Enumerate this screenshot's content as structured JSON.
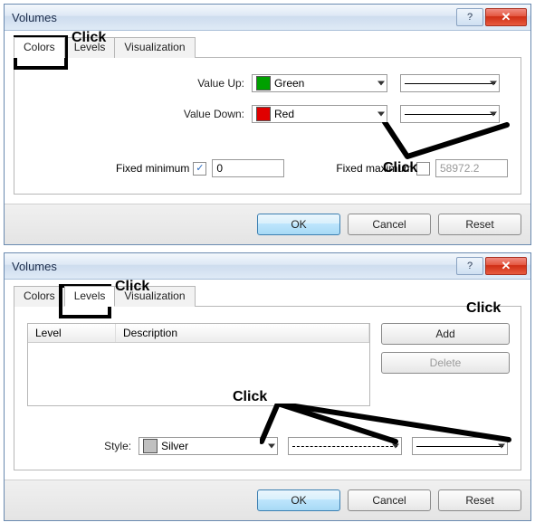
{
  "dialog1": {
    "title": "Volumes",
    "tabs": {
      "colors": "Colors",
      "levels": "Levels",
      "viz": "Visualization"
    },
    "value_up_label": "Value Up:",
    "value_up": "Green",
    "value_up_color": "#00a000",
    "value_down_label": "Value Down:",
    "value_down": "Red",
    "value_down_color": "#e00000",
    "fixed_min_label": "Fixed minimum",
    "fixed_min_value": "0",
    "fixed_max_label": "Fixed maximum",
    "fixed_max_value": "58972.2",
    "buttons": {
      "ok": "OK",
      "cancel": "Cancel",
      "reset": "Reset"
    }
  },
  "dialog2": {
    "title": "Volumes",
    "tabs": {
      "colors": "Colors",
      "levels": "Levels",
      "viz": "Visualization"
    },
    "table": {
      "level_hdr": "Level",
      "desc_hdr": "Description"
    },
    "add": "Add",
    "delete": "Delete",
    "style_label": "Style:",
    "style_value": "Silver",
    "style_color": "#c0c0c0",
    "buttons": {
      "ok": "OK",
      "cancel": "Cancel",
      "reset": "Reset"
    }
  },
  "annotations": {
    "click": "Click"
  }
}
